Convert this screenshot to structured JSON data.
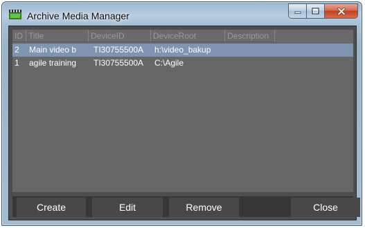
{
  "window": {
    "title": "Archive Media Manager",
    "controls": {
      "minimize": "minimize",
      "maximize": "maximize",
      "close": "close"
    }
  },
  "grid": {
    "columns": [
      "ID",
      "Title",
      "DeviceID",
      "DeviceRoot",
      "Description"
    ],
    "rows": [
      {
        "id": "2",
        "title": "Main video b",
        "device_id": "TI30755500A",
        "device_root": "h:\\video_bakup",
        "description": "",
        "selected": true
      },
      {
        "id": "1",
        "title": "agile training",
        "device_id": "TI30755500A",
        "device_root": "C:\\Agile",
        "description": "",
        "selected": false
      }
    ]
  },
  "buttons": {
    "create": "Create",
    "edit": "Edit",
    "remove": "Remove",
    "close": "Close"
  },
  "colors": {
    "client_bg": "#4e4e4e",
    "grid_bg": "#676767",
    "selected_row": "#7d95b1",
    "button_bar": "#373737",
    "button": "#484848",
    "close_button": "#c2401e"
  }
}
